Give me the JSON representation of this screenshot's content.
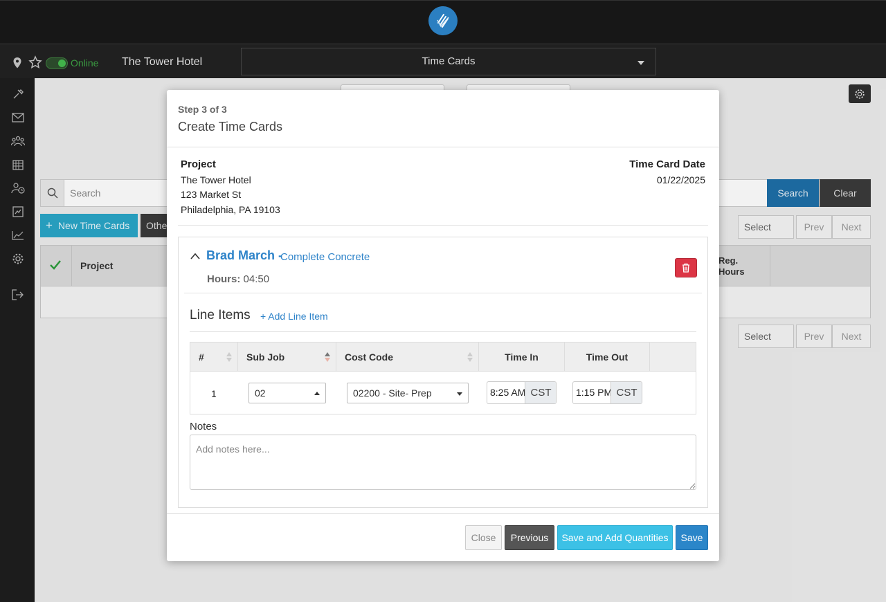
{
  "app": {
    "status_label": "Online",
    "project_name": "The Tower Hotel",
    "module_selected": "Time Cards"
  },
  "background": {
    "search_placeholder": "Search",
    "search_button": "Search",
    "clear_button": "Clear",
    "new_button": "New Time Cards",
    "other_button": "Othe",
    "select_label": "Select",
    "prev_label": "Prev",
    "next_label": "Next",
    "col_project": "Project",
    "col_reg_hours_1": "Reg.",
    "col_reg_hours_2": "Hours"
  },
  "modal": {
    "step": "Step 3 of 3",
    "title": "Create Time Cards",
    "project_label": "Project",
    "project_name": "The Tower Hotel",
    "address_line1": "123 Market St",
    "address_line2": "Philadelphia, PA 19103",
    "date_label": "Time Card Date",
    "date_value": "01/22/2025",
    "employee_name": "Brad March -",
    "employee_task": "Complete Concrete",
    "hours_label": "Hours:",
    "hours_value": "04:50",
    "line_items_title": "Line Items",
    "add_line_item": "+ Add Line Item",
    "columns": {
      "num": "#",
      "sub_job": "Sub Job",
      "cost_code": "Cost Code",
      "time_in": "Time In",
      "time_out": "Time Out"
    },
    "row": {
      "num": "1",
      "sub_job": "02",
      "cost_code": "02200 - Site- Prep",
      "time_in": "8:25 AM",
      "time_in_tz": "CST",
      "time_out": "1:15 PM",
      "time_out_tz": "CST"
    },
    "notes_label": "Notes",
    "notes_placeholder": "Add notes here...",
    "buttons": {
      "close": "Close",
      "previous": "Previous",
      "save_add_quantities": "Save and Add Quantities",
      "save": "Save"
    }
  },
  "colors": {
    "brand_blue": "#2b7fc1",
    "link_blue": "#2e83c9",
    "danger": "#dc3545",
    "online_green": "#3a9a41",
    "info": "#3cc1e6"
  },
  "icons": [
    "logo-icon",
    "location-pin-icon",
    "star-icon",
    "hammer-icon",
    "mail-icon",
    "users-icon",
    "calendar-icon",
    "user-clock-icon",
    "clipboard-chart-icon",
    "line-chart-icon",
    "gear-icon",
    "logout-icon",
    "search-icon",
    "plus-icon",
    "check-icon",
    "chevron-up-icon",
    "trash-icon"
  ]
}
